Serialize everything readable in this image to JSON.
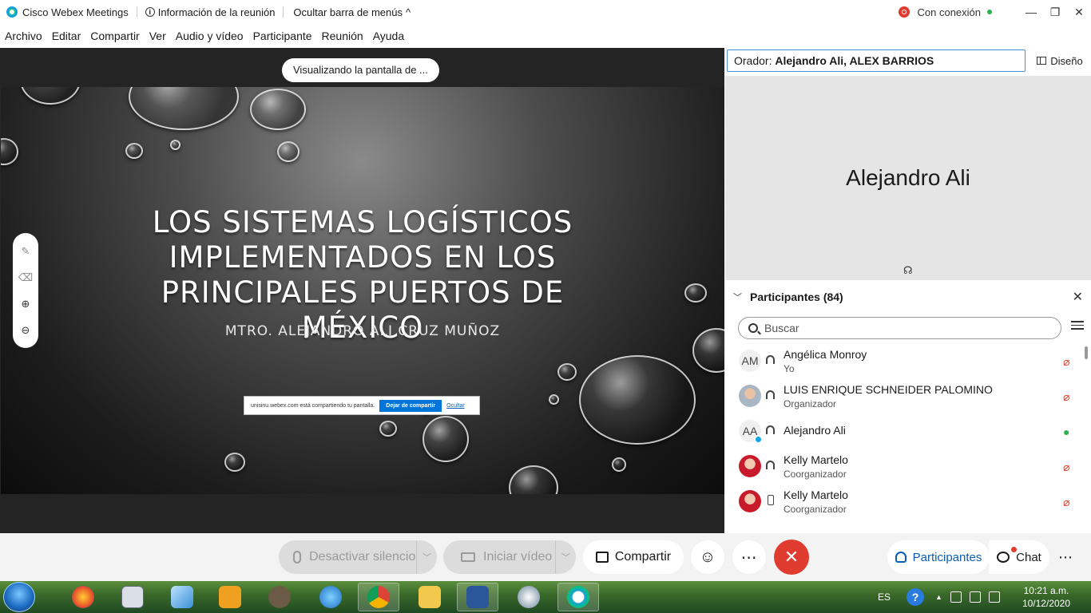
{
  "titlebar": {
    "app": "Cisco Webex Meetings",
    "info": "Información de la reunión",
    "hide_menu": "Ocultar barra de menús",
    "connection": "Con conexión"
  },
  "menu": [
    "Archivo",
    "Editar",
    "Compartir",
    "Ver",
    "Audio y vídeo",
    "Participante",
    "Reunión",
    "Ayuda"
  ],
  "share": {
    "viewing": "Visualizando la pantalla de ...",
    "slide_title": "LOS SISTEMAS LOGÍSTICOS IMPLEMENTADOS EN LOS PRINCIPALES PUERTOS DE MÉXICO",
    "slide_subtitle": "MTRO. ALEJANDRO ALI CRUZ MUÑOZ",
    "notice_text": "unisinu.webex.com está compartiendo tu pantalla.",
    "notice_stop": "Dejar de compartir",
    "notice_hide": "Ocultar"
  },
  "speaker": {
    "prefix": "Orador:",
    "names": "Alejandro Ali, ALEX BARRIOS",
    "layout": "Diseño",
    "video_name": "Alejandro Ali"
  },
  "participants": {
    "title": "Participantes (84)",
    "search_placeholder": "Buscar",
    "rows": [
      {
        "initials": "AM",
        "name": "Angélica Monroy",
        "role": "Yo",
        "device": "headset",
        "mic": "muted"
      },
      {
        "initials": "",
        "name": "LUIS ENRIQUE SCHNEIDER PALOMINO",
        "role": "Organizador",
        "device": "headset",
        "mic": "muted"
      },
      {
        "initials": "AA",
        "name": "Alejandro Ali",
        "role": "",
        "device": "headset",
        "mic": "on"
      },
      {
        "initials": "",
        "name": "Kelly Martelo",
        "role": "Coorganizador",
        "device": "headset",
        "mic": "muted"
      },
      {
        "initials": "",
        "name": "Kelly Martelo",
        "role": "Coorganizador",
        "device": "phone",
        "mic": "muted"
      }
    ]
  },
  "toolbar": {
    "mute": "Desactivar silencio",
    "video": "Iniciar vídeo",
    "share": "Compartir",
    "participants": "Participantes",
    "chat": "Chat"
  },
  "taskbar": {
    "lang": "ES",
    "time": "10:21 a.m.",
    "date": "10/12/2020"
  },
  "colors": {
    "accent": "#0b5db5",
    "leave": "#e03b2f",
    "muted": "#d93a2b",
    "unmuted": "#2bb24c"
  }
}
